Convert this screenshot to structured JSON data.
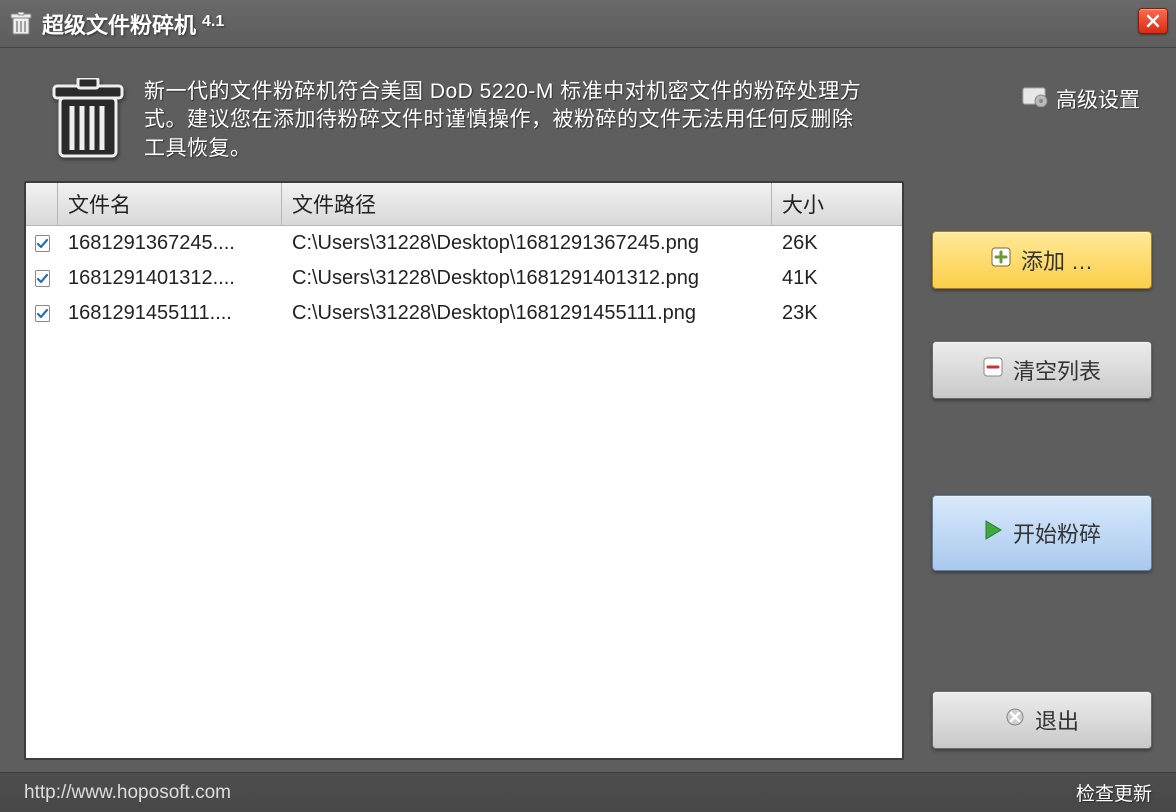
{
  "title": "超级文件粉碎机",
  "version": "4.1",
  "description": "新一代的文件粉碎机符合美国 DoD 5220-M 标准中对机密文件的粉碎处理方式。建议您在添加待粉碎文件时谨慎操作，被粉碎的文件无法用任何反删除工具恢复。",
  "advanced_settings_label": "高级设置",
  "columns": {
    "name": "文件名",
    "path": "文件路径",
    "size": "大小"
  },
  "rows": [
    {
      "checked": true,
      "name": "1681291367245....",
      "path": "C:\\Users\\31228\\Desktop\\1681291367245.png",
      "size": "26K"
    },
    {
      "checked": true,
      "name": "1681291401312....",
      "path": "C:\\Users\\31228\\Desktop\\1681291401312.png",
      "size": "41K"
    },
    {
      "checked": true,
      "name": "1681291455111....",
      "path": "C:\\Users\\31228\\Desktop\\1681291455111.png",
      "size": "23K"
    }
  ],
  "buttons": {
    "add": "添加 …",
    "clear": "清空列表",
    "start": "开始粉碎",
    "exit": "退出"
  },
  "footer": {
    "url": "http://www.hoposoft.com",
    "update": "检查更新"
  }
}
